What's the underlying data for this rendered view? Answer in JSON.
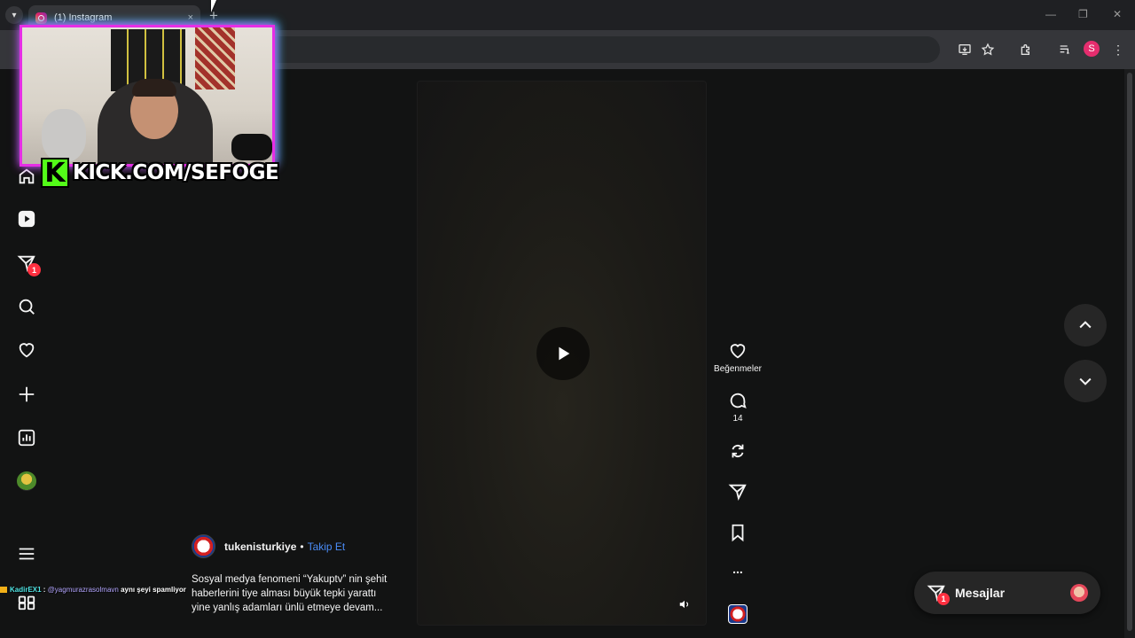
{
  "browser": {
    "tab_title": "(1) Instagram",
    "tab_close": "×",
    "new_tab": "+",
    "win_minimize": "—",
    "win_restore": "❐",
    "win_close": "✕",
    "profile_initial": "S"
  },
  "sidebar": {
    "notification_count": "1"
  },
  "stream_overlay": {
    "kick_logo": "K",
    "kick_url": "KICK.COM/SEFOGE",
    "chat": {
      "user": "KadirEX1",
      "separator": " : ",
      "mention": "@yagmurazrasolmavn",
      "text": " aynı şeyi spamliyor"
    }
  },
  "reel": {
    "author": "tukenisturkiye",
    "separator": "•",
    "follow_label": "Takip Et",
    "caption_lines": [
      "Sosyal medya fenomeni “Yakuptv” nin şehit",
      "haberlerini tiye alması büyük tepki yarattı",
      "yine yanlış adamları ünlü etmeye devam..."
    ],
    "actions": {
      "like_label": "Beğenmeler",
      "comment_count": "14",
      "more_label": "..."
    }
  },
  "messages": {
    "label": "Mesajlar",
    "badge": "1"
  },
  "colors": {
    "accent_blue": "#4a8cf7",
    "badge_red": "#ff3040",
    "kick_green": "#53fc18"
  }
}
